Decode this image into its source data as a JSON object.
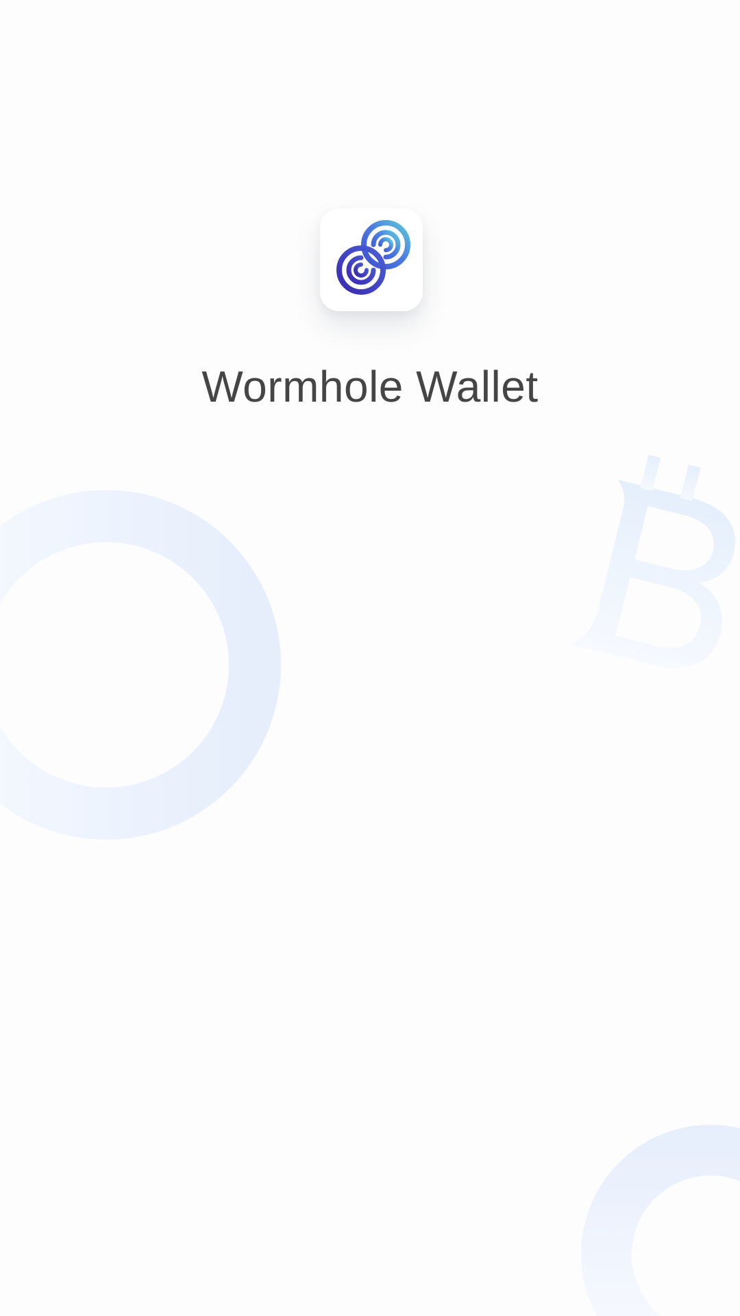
{
  "app": {
    "title": "Wormhole Wallet"
  },
  "icons": {
    "logo": "wormhole-logo-icon",
    "ring_left": "decorative-ring-icon",
    "ring_bottom_right": "decorative-ring-icon",
    "currency": "bitcoin-icon"
  },
  "colors": {
    "background": "#fdfdfd",
    "title_text": "#454545",
    "logo_primary": "#3f2fb8",
    "logo_secondary": "#4b7de0",
    "logo_accent": "#5ec4dc",
    "decor_tint": "#e8f0fd"
  }
}
